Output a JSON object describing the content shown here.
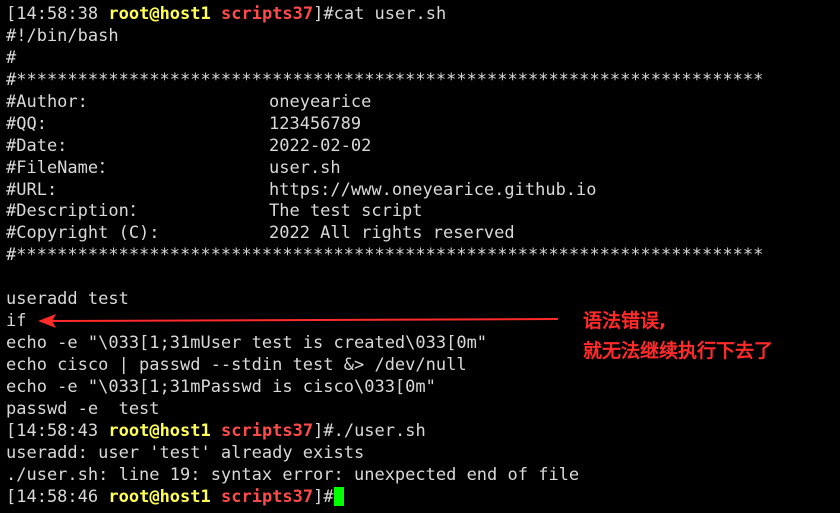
{
  "colors": {
    "background": "#000000",
    "text": "#d9d9d9",
    "prompt_user": "#ffff55",
    "prompt_dir": "#ff4a4a",
    "cursor": "#00ff00",
    "annotation": "#ff2a2a"
  },
  "prompt": {
    "user": "root",
    "at": "@",
    "host": "host1",
    "dir": "scripts37"
  },
  "prompts": [
    {
      "time": "[14:58:38 ",
      "cmd": "]#cat user.sh"
    },
    {
      "time": "[14:58:43 ",
      "cmd": "]#./user.sh"
    },
    {
      "time": "[14:58:46 ",
      "cmd": "]#"
    }
  ],
  "script_header": {
    "shebang": "#!/bin/bash",
    "hash": "#",
    "border": "#*************************************************************************",
    "fields": [
      {
        "key": "#Author:",
        "value": "oneyearice"
      },
      {
        "key": "#QQ:",
        "value": "123456789"
      },
      {
        "key": "#Date:",
        "value": "2022-02-02"
      },
      {
        "key": "#FileName：",
        "value": "user.sh"
      },
      {
        "key": "#URL:",
        "value": "https://www.oneyearice.github.io"
      },
      {
        "key": "#Description：",
        "value": "The test script"
      },
      {
        "key": "#Copyright (C):",
        "value": "2022 All rights reserved"
      }
    ]
  },
  "script_body": [
    "useradd test",
    "if",
    "echo -e \"\\033[1;31mUser test is created\\033[0m\"",
    "echo cisco | passwd --stdin test &> /dev/null",
    "echo -e \"\\033[1;31mPasswd is cisco\\033[0m\"",
    "passwd -e  test"
  ],
  "output": [
    "useradd: user 'test' already exists",
    "./user.sh: line 19: syntax error: unexpected end of file"
  ],
  "annotation": {
    "line1": "语法错误,",
    "line2": "就无法继续执行下去了"
  }
}
